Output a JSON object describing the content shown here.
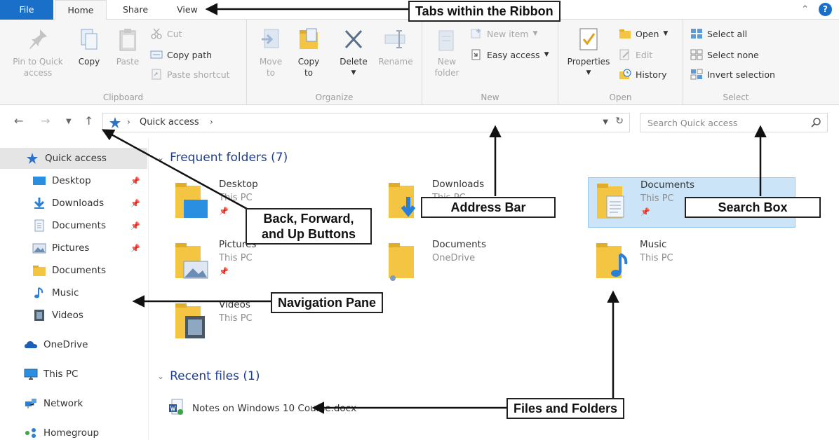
{
  "tabs": {
    "file": "File",
    "home": "Home",
    "share": "Share",
    "view": "View"
  },
  "ribbon": {
    "clipboard": {
      "label": "Clipboard",
      "pin_quick_access": "Pin to Quick access",
      "copy": "Copy",
      "paste": "Paste",
      "cut": "Cut",
      "copy_path": "Copy path",
      "paste_shortcut": "Paste shortcut"
    },
    "organize": {
      "label": "Organize",
      "move_to": "Move to",
      "copy_to": "Copy to",
      "delete": "Delete",
      "rename": "Rename"
    },
    "new": {
      "label": "New",
      "new_folder": "New folder",
      "new_item": "New item",
      "easy_access": "Easy access"
    },
    "open": {
      "label": "Open",
      "properties": "Properties",
      "open": "Open",
      "edit": "Edit",
      "history": "History"
    },
    "select": {
      "label": "Select",
      "select_all": "Select all",
      "select_none": "Select none",
      "invert_selection": "Invert selection"
    }
  },
  "address": {
    "path": "Quick access",
    "search_placeholder": "Search Quick access"
  },
  "nav_pane": {
    "items": [
      {
        "label": "Quick access"
      },
      {
        "label": "Desktop"
      },
      {
        "label": "Downloads"
      },
      {
        "label": "Documents"
      },
      {
        "label": "Pictures"
      },
      {
        "label": "Documents"
      },
      {
        "label": "Music"
      },
      {
        "label": "Videos"
      },
      {
        "label": "OneDrive"
      },
      {
        "label": "This PC"
      },
      {
        "label": "Network"
      },
      {
        "label": "Homegroup"
      }
    ]
  },
  "content": {
    "frequent_header": "Frequent folders (7)",
    "folders": [
      {
        "name": "Desktop",
        "location": "This PC"
      },
      {
        "name": "Downloads",
        "location": "This PC"
      },
      {
        "name": "Documents",
        "location": "This PC"
      },
      {
        "name": "Pictures",
        "location": "This PC"
      },
      {
        "name": "Documents",
        "location": "OneDrive"
      },
      {
        "name": "Music",
        "location": "This PC"
      },
      {
        "name": "Videos",
        "location": "This PC"
      }
    ],
    "recent_header": "Recent files (1)",
    "recent_files": [
      {
        "name": "Notes on Windows 10 Course.docx"
      }
    ]
  },
  "callouts": {
    "tabs": "Tabs within the Ribbon",
    "back_forward_up_line1": "Back, Forward,",
    "back_forward_up_line2": "and Up Buttons",
    "address_bar": "Address Bar",
    "search_box": "Search Box",
    "navigation_pane": "Navigation Pane",
    "files_and_folders": "Files and Folders"
  },
  "colors": {
    "accent": "#1a6fc9",
    "selection": "#cce4f7",
    "folder": "#f4c542",
    "section_header": "#1e3f8f"
  }
}
